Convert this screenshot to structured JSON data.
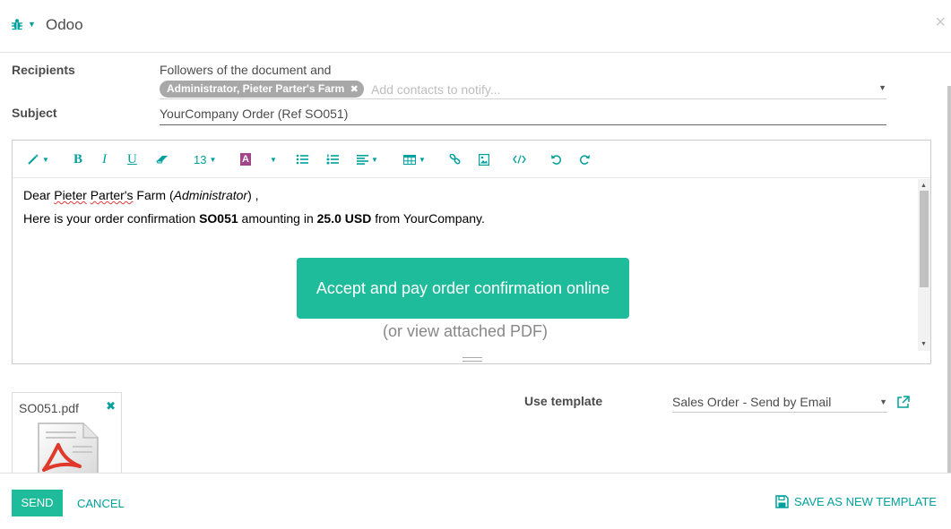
{
  "header": {
    "title": "Odoo",
    "debug_icon": "bug-icon",
    "close_symbol": "×"
  },
  "form": {
    "recipients_label": "Recipients",
    "followers_text": "Followers of the document and",
    "recipient_tags": [
      {
        "label": "Administrator, Pieter Parter's Farm",
        "remove_symbol": "✖"
      }
    ],
    "contacts_placeholder": "Add contacts to notify...",
    "subject_label": "Subject",
    "subject_value": "YourCompany Order (Ref SO051)"
  },
  "toolbar": {
    "font_size": "13",
    "buttons": [
      "magic-wand",
      "bold",
      "italic",
      "underline",
      "eraser",
      "font-size",
      "font-color",
      "bullet-list",
      "numbered-list",
      "paragraph-align",
      "table",
      "link",
      "image",
      "code-view",
      "undo",
      "redo"
    ],
    "bold_glyph": "B",
    "italic_glyph": "I",
    "underline_glyph": "U",
    "color_glyph": "A"
  },
  "body": {
    "greeting_prefix": "Dear ",
    "partner_name_part1": "Pieter",
    "partner_name_part2": "Parter's",
    "partner_name_part3": " Farm (",
    "partner_contact": "Administrator",
    "greeting_suffix": ") ,",
    "line2_prefix": "Here is your order confirmation ",
    "order_ref": "SO051",
    "line2_mid": " amounting in ",
    "amount": "25.0 USD",
    "line2_suffix": " from YourCompany.",
    "cta_label": "Accept and pay order confirmation online",
    "pdf_link": "(or view attached PDF)"
  },
  "attachment": {
    "filename": "SO051.pdf",
    "remove_symbol": "✖"
  },
  "template": {
    "label": "Use template",
    "selected": "Sales Order - Send by Email"
  },
  "footer": {
    "send_label": "SEND",
    "cancel_label": "CANCEL",
    "save_template_label": "SAVE AS NEW TEMPLATE"
  },
  "colors": {
    "accent": "#00a09d",
    "primary_button": "#1fbc9b",
    "tag_bg": "#a8a8a8"
  }
}
